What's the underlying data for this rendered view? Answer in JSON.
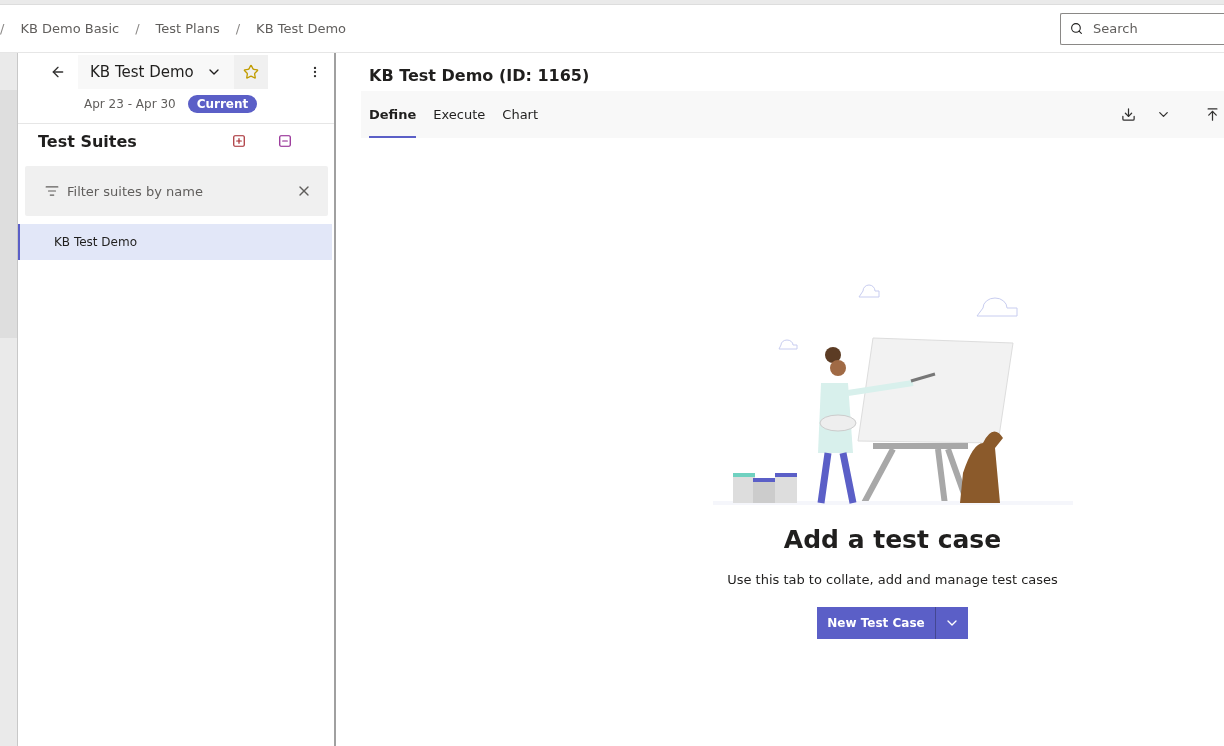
{
  "breadcrumb": {
    "separator": "/",
    "items": [
      "KB Demo Basic",
      "Test Plans",
      "KB Test Demo"
    ]
  },
  "search": {
    "placeholder": "Search"
  },
  "plan": {
    "name": "KB Test Demo",
    "dates": "Apr 23 - Apr 30",
    "badge": "Current",
    "favorite": false
  },
  "suites": {
    "title": "Test Suites",
    "filter_placeholder": "Filter suites by name",
    "items": [
      {
        "label": "KB Test Demo",
        "selected": true
      }
    ]
  },
  "main": {
    "title": "KB Test Demo (ID: 1165)",
    "tabs": [
      {
        "label": "Define",
        "selected": true
      },
      {
        "label": "Execute",
        "selected": false
      },
      {
        "label": "Chart",
        "selected": false
      }
    ]
  },
  "empty": {
    "heading": "Add a test case",
    "text": "Use this tab to collate, add and manage test cases",
    "button": "New Test Case"
  }
}
